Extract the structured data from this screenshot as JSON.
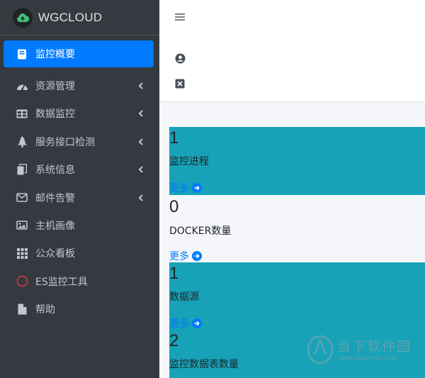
{
  "brand": {
    "name": "WGCLOUD"
  },
  "sidebar": {
    "items": [
      {
        "label": "监控概要",
        "icon": "book-icon",
        "active": true,
        "has_arrow": false
      },
      {
        "label": "资源管理",
        "icon": "dashboard-icon",
        "active": false,
        "has_arrow": true
      },
      {
        "label": "数据监控",
        "icon": "table-icon",
        "active": false,
        "has_arrow": true
      },
      {
        "label": "服务接口检测",
        "icon": "tree-icon",
        "active": false,
        "has_arrow": true
      },
      {
        "label": "系统信息",
        "icon": "copy-icon",
        "active": false,
        "has_arrow": true
      },
      {
        "label": "邮件告警",
        "icon": "envelope-icon",
        "active": false,
        "has_arrow": true
      },
      {
        "label": "主机画像",
        "icon": "image-icon",
        "active": false,
        "has_arrow": false
      },
      {
        "label": "公众看板",
        "icon": "grid-icon",
        "active": false,
        "has_arrow": false
      },
      {
        "label": "ES监控工具",
        "icon": "circle-icon",
        "active": false,
        "has_arrow": false
      },
      {
        "label": "帮助",
        "icon": "file-icon",
        "active": false,
        "has_arrow": false
      }
    ]
  },
  "header": {
    "icons": [
      "menu-icon",
      "user-circle-icon",
      "close-box-icon"
    ]
  },
  "boxes": [
    {
      "count": "1",
      "label": "监控进程",
      "more": "更多",
      "color": "#17a2b8"
    },
    {
      "count": "0",
      "label": "DOCKER数量",
      "more": "更多",
      "color": "#f4f6f9"
    },
    {
      "count": "1",
      "label": "数据源",
      "more": "更多",
      "color": "#17a2b8"
    },
    {
      "count": "2",
      "label": "监控数据表数量",
      "more": "",
      "color": "#17a2b8"
    }
  ],
  "watermark": {
    "text": "当下软件园",
    "url": "www.downxia.com"
  },
  "colors": {
    "sidebar_bg": "#343a40",
    "active": "#007bff",
    "teal": "#17a2b8",
    "page_bg": "#f4f6f9"
  }
}
